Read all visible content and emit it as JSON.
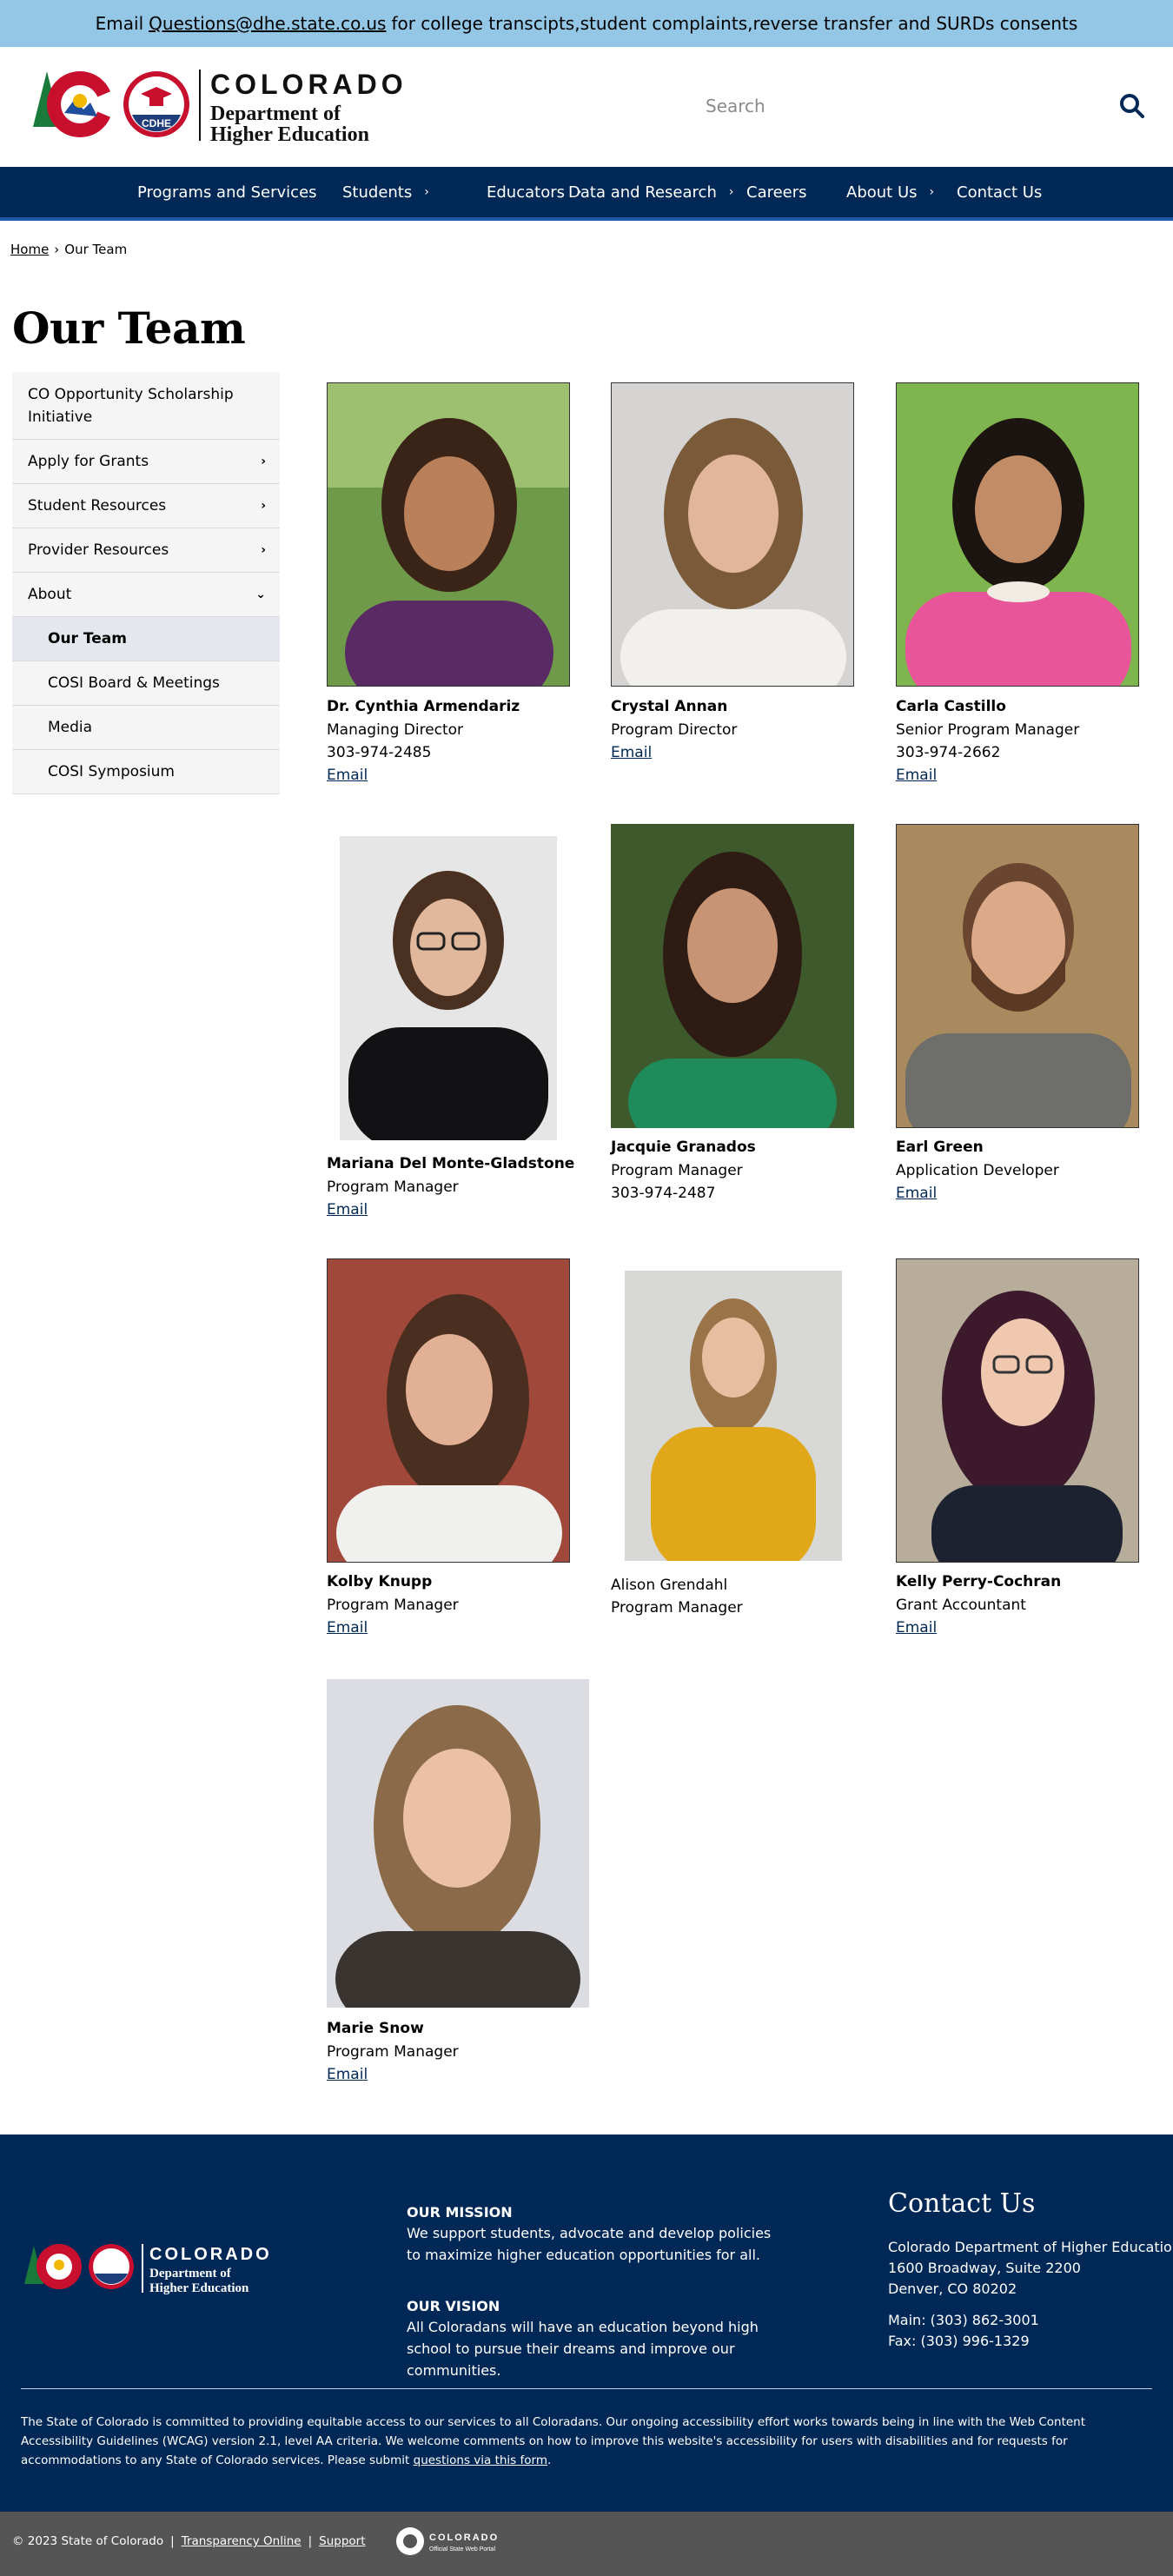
{
  "banner": {
    "prefix": "Email",
    "email": "Questions@dhe.state.co.us",
    "suffix": "for college transcipts,student complaints,reverse transfer and SURDs consents"
  },
  "header": {
    "logo_wordmark": "COLORADO",
    "logo_line1": "Department of",
    "logo_line2": "Higher Education",
    "logo_badge": "CDHE",
    "search_placeholder": "Search",
    "search_icon": "magnifier"
  },
  "nav": {
    "items": [
      {
        "label": "Programs and Services",
        "has_chevron": false
      },
      {
        "label": "Students",
        "has_chevron": true
      },
      {
        "label": "Educators",
        "has_chevron": true
      },
      {
        "label": "Data and Research",
        "has_chevron": true
      },
      {
        "label": "Careers",
        "has_chevron": false
      },
      {
        "label": "About Us",
        "has_chevron": true
      },
      {
        "label": "Contact Us",
        "has_chevron": false
      }
    ]
  },
  "breadcrumb": {
    "home": "Home",
    "separator": "›",
    "current": "Our Team"
  },
  "page": {
    "title": "Our Team"
  },
  "sidebar": {
    "items": [
      {
        "label": "CO Opportunity Scholarship Initiative",
        "chevron": ""
      },
      {
        "label": "Apply for Grants",
        "chevron": "›"
      },
      {
        "label": "Student Resources",
        "chevron": "›"
      },
      {
        "label": "Provider Resources",
        "chevron": "›"
      },
      {
        "label": "About",
        "chevron": "⌄"
      },
      {
        "label": "Our Team",
        "chevron": ""
      },
      {
        "label": "COSI Board & Meetings",
        "chevron": ""
      },
      {
        "label": "Media",
        "chevron": ""
      },
      {
        "label": "COSI Symposium",
        "chevron": ""
      }
    ]
  },
  "team": [
    {
      "name": "Dr. Cynthia Armendariz",
      "title": "Managing Director",
      "phone": "303-974-2485",
      "email": "Email"
    },
    {
      "name": "Crystal Annan",
      "title": "Program Director",
      "phone": "",
      "email": "Email"
    },
    {
      "name": "Carla Castillo",
      "title": "Senior Program Manager",
      "phone": "303-974-2662",
      "email": "Email"
    },
    {
      "name": "Mariana Del Monte-Gladstone",
      "title": "Program Manager",
      "phone": "",
      "email": "Email"
    },
    {
      "name": "Jacquie Granados",
      "title": "Program Manager",
      "phone": "303-974-2487",
      "email": ""
    },
    {
      "name": "Earl Green",
      "title": "Application Developer",
      "phone": "",
      "email": "Email"
    },
    {
      "name": "Kolby Knupp",
      "title": "Program Manager",
      "phone": "",
      "email": "Email"
    },
    {
      "name": "Alison Grendahl",
      "title": "Program Manager",
      "phone": "",
      "email": ""
    },
    {
      "name": "Kelly Perry-Cochran",
      "title": "Grant Accountant",
      "phone": "",
      "email": "Email"
    },
    {
      "name": "Marie Snow",
      "title": "Program Manager",
      "phone": "",
      "email": "Email"
    }
  ],
  "footer": {
    "mission_heading": "OUR MISSION",
    "mission_text": "We support students, advocate and develop policies to maximize higher education opportunities for all.",
    "vision_heading": "OUR VISION",
    "vision_text": "All Coloradans will have an education beyond high school to pursue their dreams and improve our communities.",
    "contact_title": "Contact Us",
    "contact_org": "Colorado Department of Higher Education",
    "contact_street": "1600 Broadway, Suite 2200",
    "contact_city": "Denver, CO 80202",
    "contact_main": "Main: (303) 862-3001",
    "contact_fax": "Fax: (303) 996-1329",
    "access_text": "The State of Colorado is committed to providing equitable access to our services to all Coloradans. Our ongoing accessibility effort works towards being in line with the Web Content Accessibility Guidelines (WCAG) version 2.1, level AA criteria. We welcome comments on how to improve this website's accessibility for users with disabilities and for requests for accommodations to any State of Colorado services. Please submit",
    "access_link": "questions via this form",
    "access_end": "."
  },
  "bottom_bar": {
    "copyright": "© 2023 State of Colorado",
    "sep": "|",
    "transparency": "Transparency Online",
    "support": "Support",
    "portal_wordmark": "COLORADO",
    "portal_sub": "Official State Web Portal"
  },
  "colors": {
    "nav_bg": "#002856",
    "banner_bg": "#93c7e5",
    "link": "#002856",
    "footer_bg": "#002856",
    "bottom_bg": "#555555"
  }
}
